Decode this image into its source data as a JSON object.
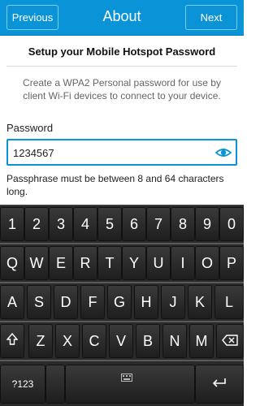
{
  "header": {
    "title": "About",
    "previous_label": "Previous",
    "next_label": "Next"
  },
  "content": {
    "heading": "Setup your Mobile Hotspot Password",
    "description": "Create a WPA2 Personal password for use by client Wi-Fi devices to connect to your device.",
    "password_label": "Password",
    "password_value": "1234567",
    "hint": "Passphrase must be between 8 and 64 characters long."
  },
  "keyboard": {
    "row1": [
      "1",
      "2",
      "3",
      "4",
      "5",
      "6",
      "7",
      "8",
      "9",
      "0"
    ],
    "row2": [
      "Q",
      "W",
      "E",
      "R",
      "T",
      "Y",
      "U",
      "I",
      "O",
      "P"
    ],
    "row3": [
      "A",
      "S",
      "D",
      "F",
      "G",
      "H",
      "J",
      "K",
      "L"
    ],
    "row4": [
      "Z",
      "X",
      "C",
      "V",
      "B",
      "N",
      "M"
    ],
    "sym_label": "?123",
    "shift_icon": "shift-icon",
    "backspace_icon": "backspace-icon",
    "keyboard_icon": "keyboard-icon",
    "enter_icon": "enter-icon"
  },
  "colors": {
    "accent": "#0a93d6",
    "keyboard_bg": "#2a2a2a"
  }
}
